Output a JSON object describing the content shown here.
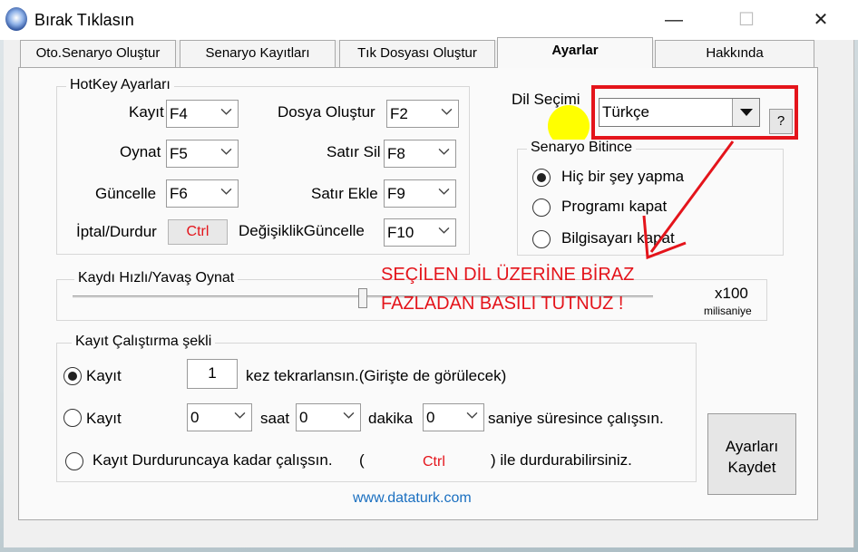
{
  "window": {
    "title": "Bırak Tıklasın"
  },
  "tabs": [
    "Oto.Senaryo Oluştur",
    "Senaryo Kayıtları",
    "Tık Dosyası Oluştur",
    "Ayarlar",
    "Hakkında"
  ],
  "hotkeys": {
    "legend": "HotKey Ayarları",
    "record_label": "Kayıt",
    "record_value": "F4",
    "play_label": "Oynat",
    "play_value": "F5",
    "update_label": "Güncelle",
    "update_value": "F6",
    "cancel_label": "İptal/Durdur",
    "cancel_value": "Ctrl",
    "create_file_label": "Dosya Oluştur",
    "create_file_value": "F2",
    "delete_row_label": "Satır Sil",
    "delete_row_value": "F8",
    "add_row_label": "Satır Ekle",
    "add_row_value": "F9",
    "change_update_label": "DeğişiklikGüncelle",
    "change_update_value": "F10"
  },
  "language": {
    "label": "Dil Seçimi",
    "value": "Türkçe",
    "help": "?"
  },
  "scenario_end": {
    "legend": "Senaryo Bitince",
    "options": [
      "Hiç bir şey yapma",
      "Programı kapat",
      "Bilgisayarı kapat"
    ],
    "selected": "Hiç bir şey yapma"
  },
  "speed": {
    "legend": "Kaydı Hızlı/Yavaş Oynat",
    "multiplier": "x100",
    "unit": "milisaniye",
    "slider_fraction": 0.5
  },
  "annotation": {
    "line1": "SEÇİLEN DİL ÜZERİNE BİRAZ",
    "line2": "FAZLADAN BASILI TUTNUZ !"
  },
  "run_mode": {
    "legend": "Kayıt Çalıştırma şekli",
    "opt1_label": "Kayıt",
    "repeat_value": "1",
    "repeat_suffix": "kez tekrarlansın.(Girişte de görülecek)",
    "opt2_label": "Kayıt",
    "hour_value": "0",
    "hour_label": "saat",
    "minute_value": "0",
    "minute_label": "dakika",
    "second_value": "0",
    "second_suffix": "saniye süresince çalışsın.",
    "opt3_label": "Kayıt Durduruncaya kadar çalışsın.",
    "paren_open": "(",
    "stop_key": "Ctrl",
    "paren_close": ") ile durdurabilirsiniz."
  },
  "save_button": {
    "line1": "Ayarları",
    "line2": "Kaydet"
  },
  "footer": {
    "url": "www.dataturk.com"
  },
  "colors": {
    "accent_red": "#e4141b",
    "link_blue": "#1a6fc0",
    "highlight_yellow": "#ffff00"
  }
}
